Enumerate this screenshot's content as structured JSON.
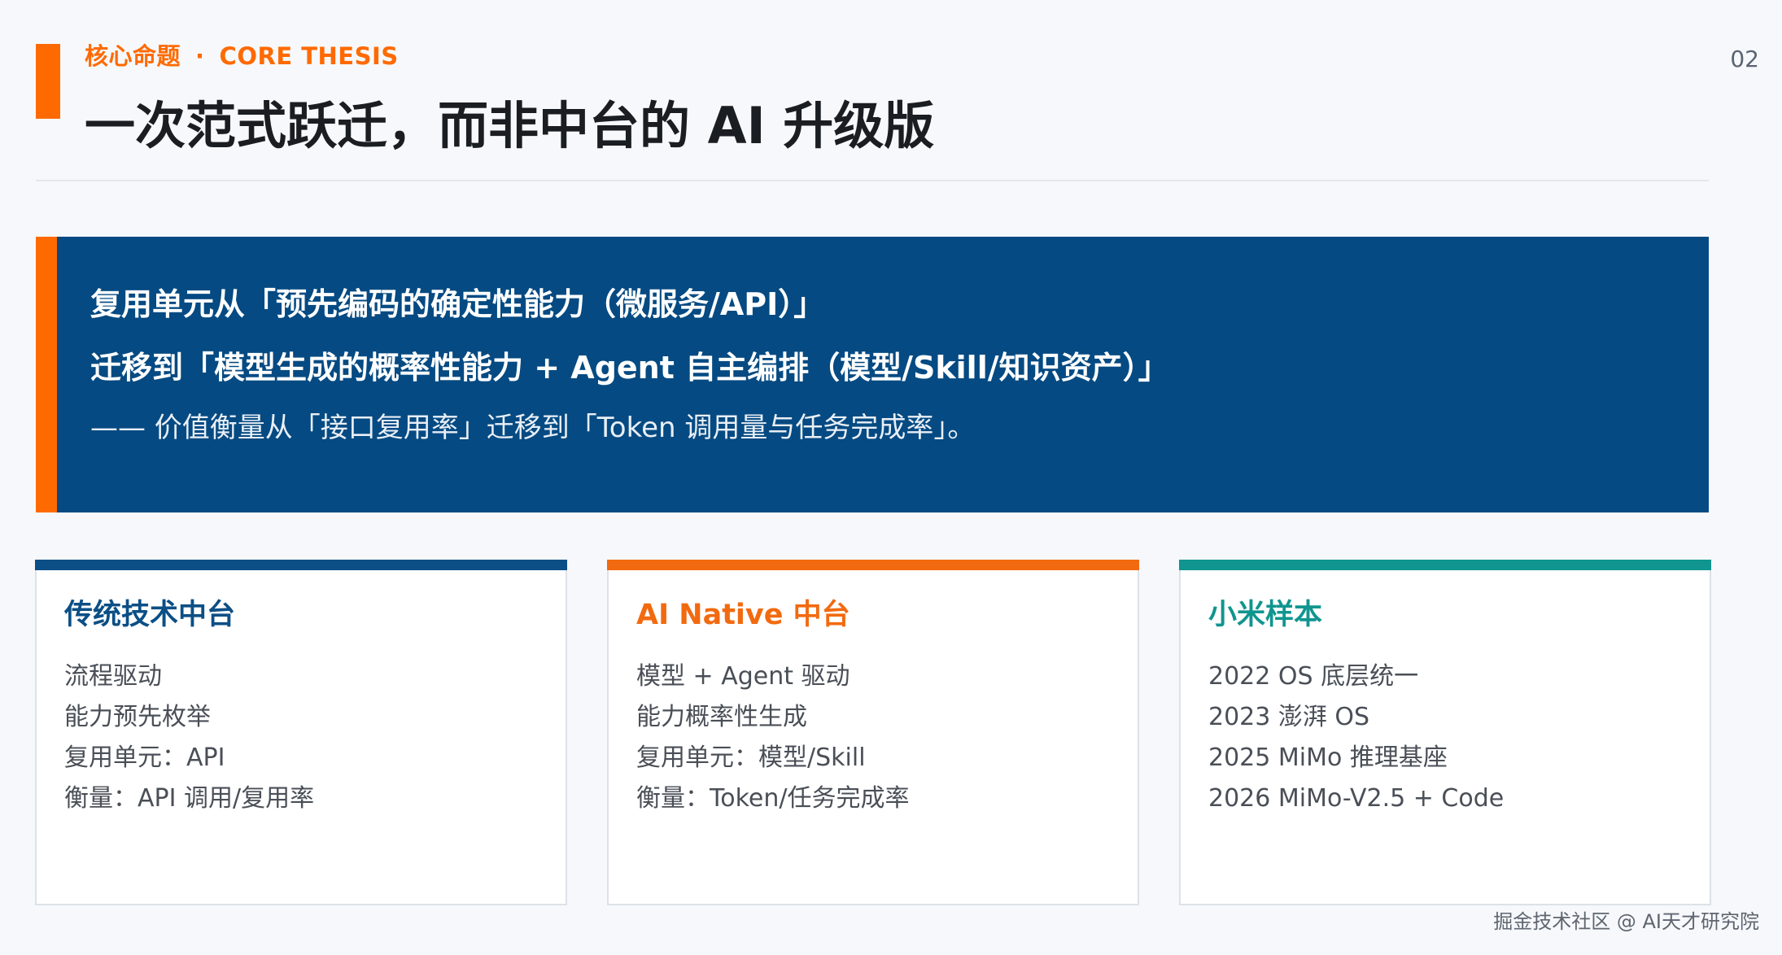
{
  "header": {
    "eyebrow_cn": "核心命题",
    "eyebrow_dot": "·",
    "eyebrow_en": "CORE THESIS",
    "title": "一次范式跃迁，而非中台的 AI 升级版",
    "page_number": "02",
    "accent_color": "#ff6a00"
  },
  "thesis": {
    "line1": "复用单元从「预先编码的确定性能力（微服务/API）」",
    "line2": "迁移到「模型生成的概率性能力 + Agent 自主编排（模型/Skill/知识资产）」",
    "line3": "—— 价值衡量从「接口复用率」迁移到「Token 调用量与任务完成率」。",
    "background_color": "#054a82",
    "accent_color": "#ff6a00"
  },
  "cards": [
    {
      "title": "传统技术中台",
      "color": "#0b4f86",
      "items": [
        "流程驱动",
        "能力预先枚举",
        "复用单元：API",
        "衡量：API 调用/复用率"
      ]
    },
    {
      "title": "AI Native 中台",
      "color": "#f26a10",
      "items": [
        "模型 + Agent 驱动",
        "能力概率性生成",
        "复用单元：模型/Skill",
        "衡量：Token/任务完成率"
      ]
    },
    {
      "title": "小米样本",
      "color": "#10958f",
      "items": [
        "2022 OS 底层统一",
        "2023 澎湃 OS",
        "2025 MiMo 推理基座",
        "2026 MiMo-V2.5 + Code"
      ]
    }
  ],
  "footer": {
    "watermark": "掘金技术社区 @ AI天才研究院"
  }
}
